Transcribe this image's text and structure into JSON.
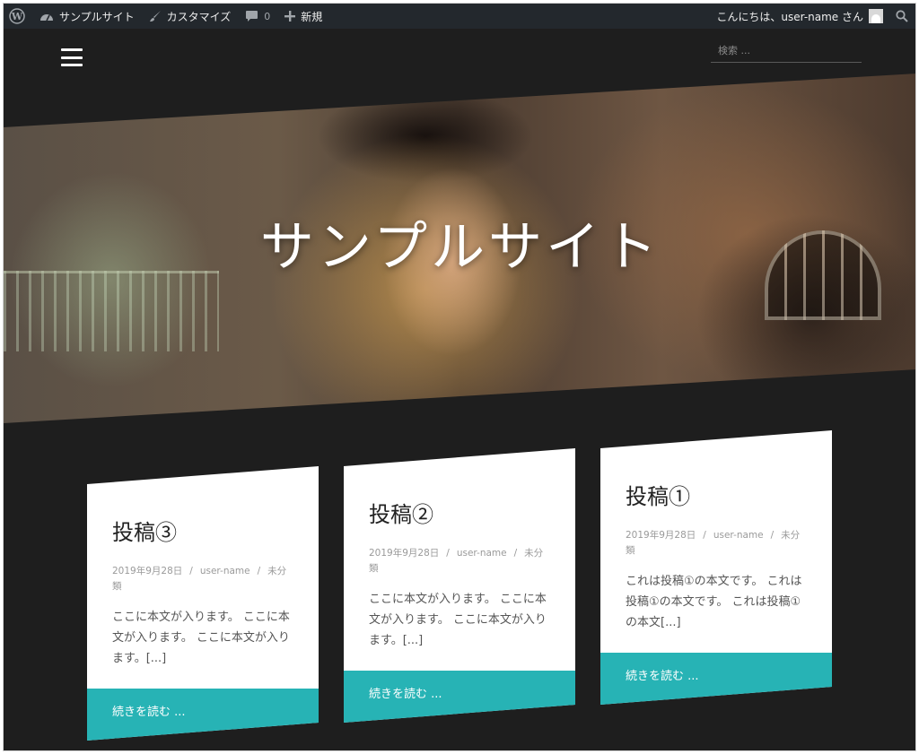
{
  "adminbar": {
    "site_name": "サンプルサイト",
    "customize": "カスタマイズ",
    "comments_count": "0",
    "new_label": "新規",
    "greeting": "こんにちは、user-name さん"
  },
  "header": {
    "search_placeholder": "検索 ..."
  },
  "hero": {
    "title": "サンプルサイト"
  },
  "posts": [
    {
      "title": "投稿③",
      "date": "2019年9月28日",
      "author": "user-name",
      "category": "未分類",
      "excerpt": "ここに本文が入ります。 ここに本文が入ります。 ここに本文が入ります。[...]",
      "read_more": "続きを読む ..."
    },
    {
      "title": "投稿②",
      "date": "2019年9月28日",
      "author": "user-name",
      "category": "未分類",
      "excerpt": "ここに本文が入ります。 ここに本文が入ります。 ここに本文が入ります。[...]",
      "read_more": "続きを読む ..."
    },
    {
      "title": "投稿①",
      "date": "2019年9月28日",
      "author": "user-name",
      "category": "未分類",
      "excerpt": "これは投稿①の本文です。 これは投稿①の本文です。 これは投稿①の本文[...]",
      "read_more": "続きを読む ..."
    }
  ],
  "colors": {
    "admin_bar": "#23282d",
    "page_background": "#1e1e1e",
    "accent": "#27b3b5"
  }
}
